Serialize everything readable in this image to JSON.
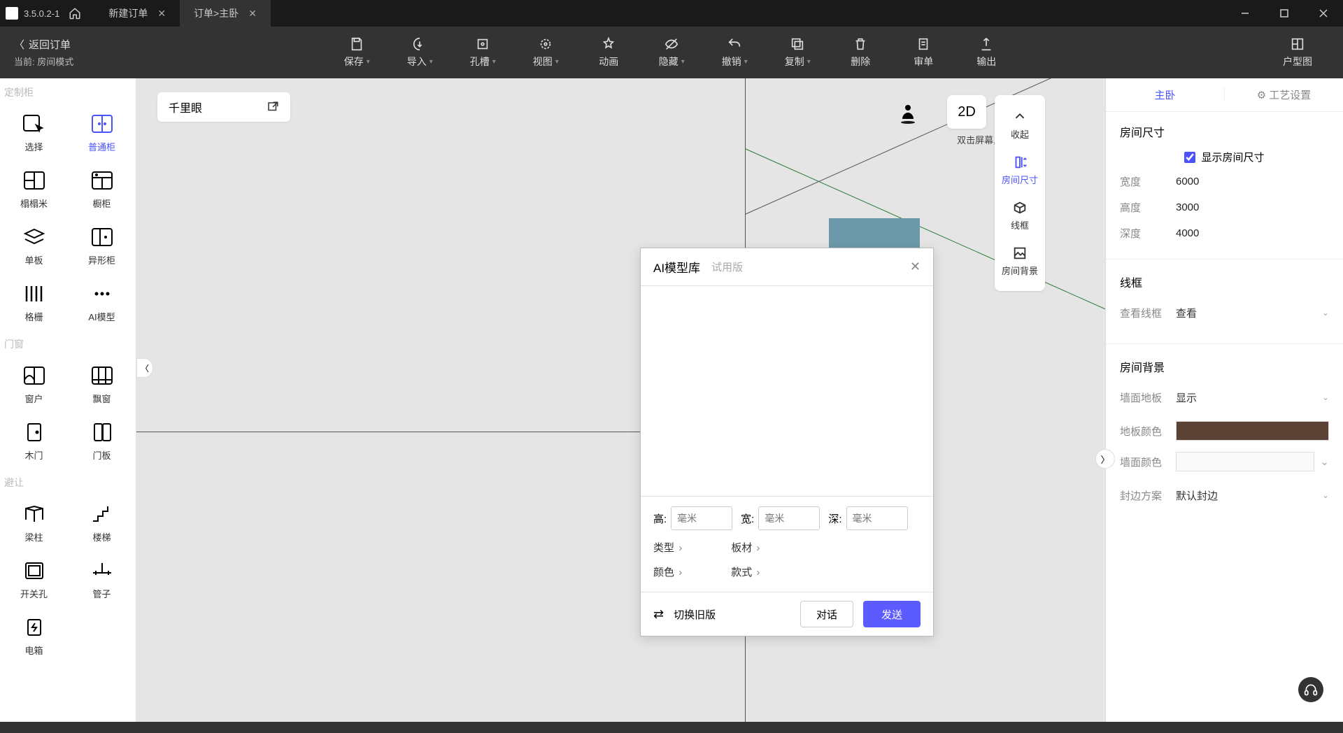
{
  "titlebar": {
    "version": "3.5.0.2-1",
    "tabs": [
      {
        "label": "新建订单",
        "active": false
      },
      {
        "label": "订单>主卧",
        "active": true
      }
    ]
  },
  "toolbar": {
    "back_label": "返回订单",
    "current_prefix": "当前:",
    "current_value": "房间模式",
    "buttons": {
      "save": "保存",
      "import": "导入",
      "slot": "孔槽",
      "view": "视图",
      "anim": "动画",
      "hide": "隐藏",
      "undo": "撤销",
      "copy": "复制",
      "delete": "删除",
      "review": "审单",
      "export": "输出",
      "floorplan": "户型图"
    }
  },
  "left_panel": {
    "sections": {
      "cabinet": "定制柜",
      "door": "门窗",
      "avoid": "避让"
    },
    "items": {
      "select": "选择",
      "normal_cabinet": "普通柜",
      "tatami": "榻榻米",
      "kitchen_cabinet": "橱柜",
      "single_board": "单板",
      "special_cabinet": "异形柜",
      "grid": "格栅",
      "ai_model": "AI模型",
      "window": "窗户",
      "bay_window": "飘窗",
      "wood_door": "木门",
      "door_panel": "门板",
      "beam": "梁柱",
      "stair": "楼梯",
      "switch_hole": "开关孔",
      "pipe": "管子",
      "ebox": "电箱"
    }
  },
  "canvas": {
    "eagle": "千里眼",
    "mode_2d": "2D",
    "hint": "双击屏幕, 快捷键Esc",
    "side_toggles": {
      "collapse": "收起",
      "room_size": "房间尺寸",
      "wireframe": "线框",
      "room_bg": "房间背景"
    }
  },
  "modal": {
    "title": "AI模型库",
    "trial": "试用版",
    "dims": {
      "h": "高:",
      "w": "宽:",
      "d": "深:",
      "placeholder": "毫米"
    },
    "filters": {
      "type": "类型",
      "board": "板材",
      "color": "颜色",
      "style": "款式"
    },
    "switch": "切换旧版",
    "dialog": "对话",
    "send": "发送"
  },
  "right_panel": {
    "tabs": {
      "main": "主卧",
      "craft": "工艺设置"
    },
    "room_size": {
      "title": "房间尺寸",
      "show_label": "显示房间尺寸",
      "width_lbl": "宽度",
      "width_val": "6000",
      "height_lbl": "高度",
      "height_val": "3000",
      "depth_lbl": "深度",
      "depth_val": "4000"
    },
    "wire": {
      "title": "线框",
      "view_lbl": "查看线框",
      "view_val": "查看"
    },
    "bg": {
      "title": "房间背景",
      "wallfloor_lbl": "墙面地板",
      "wallfloor_val": "显示",
      "floor_color_lbl": "地板颜色",
      "wall_color_lbl": "墙面颜色",
      "edge_lbl": "封边方案",
      "edge_val": "默认封边"
    }
  }
}
